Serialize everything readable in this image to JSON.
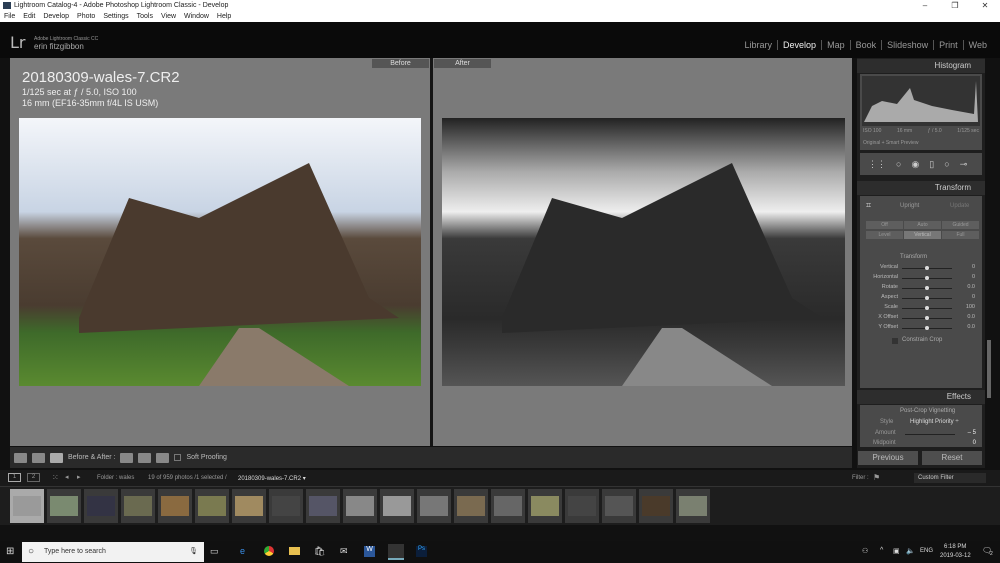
{
  "window": {
    "title": "Lightroom Catalog-4 - Adobe Photoshop Lightroom Classic - Develop",
    "min": "–",
    "max": "❐",
    "close": "✕"
  },
  "menu": [
    "File",
    "Edit",
    "Develop",
    "Photo",
    "Settings",
    "Tools",
    "View",
    "Window",
    "Help"
  ],
  "brand": {
    "logo": "Lr",
    "product": "Adobe Lightroom Classic CC",
    "user": "erin fitzgibbon"
  },
  "modules": [
    "Library",
    "Develop",
    "Map",
    "Book",
    "Slideshow",
    "Print",
    "Web"
  ],
  "view": {
    "before": "Before",
    "after": "After",
    "filename": "20180309-wales-7.CR2",
    "exposure": "1/125 sec at ƒ / 5.0, ISO 100",
    "lens": "16 mm (EF16-35mm f/4L IS USM)"
  },
  "toolbar": {
    "before_after": "Before & After :",
    "soft_proofing": "Soft Proofing"
  },
  "histogram": {
    "title": "Histogram",
    "iso": "ISO 100",
    "focal": "16 mm",
    "aperture": "ƒ / 5.0",
    "shutter": "1/125 sec",
    "preview": "Original + Smart Preview"
  },
  "transform": {
    "title": "Transform",
    "upright": "Upright",
    "update": "Update",
    "buttons": [
      "Off",
      "Auto",
      "Guided",
      "Level",
      "Vertical",
      "Full"
    ],
    "section": "Transform",
    "sliders": [
      {
        "label": "Vertical",
        "value": "0"
      },
      {
        "label": "Horizontal",
        "value": "0"
      },
      {
        "label": "Rotate",
        "value": "0.0"
      },
      {
        "label": "Aspect",
        "value": "0"
      },
      {
        "label": "Scale",
        "value": "100"
      },
      {
        "label": "X Offset",
        "value": "0.0"
      },
      {
        "label": "Y Offset",
        "value": "0.0"
      }
    ],
    "constrain": "Constrain Crop"
  },
  "effects": {
    "title": "Effects",
    "section": "Post-Crop Vignetting",
    "style_label": "Style",
    "style_value": "Highlight Priority ÷",
    "amount_label": "Amount",
    "amount_value": "– 5",
    "midpoint_label": "Midpoint",
    "midpoint_value": "0"
  },
  "actions": {
    "previous": "Previous",
    "reset": "Reset"
  },
  "filmstrip": {
    "page1": "1",
    "page2": "2",
    "source": "Folder : wales",
    "count": "19 of 959 photos /1 selected /",
    "selected": "20180309-wales-7.CR2 ▾",
    "filter_label": "Filter :",
    "filter_value": "Custom Filter",
    "thumbs": [
      "#9a9a9a",
      "#7a8a70",
      "#334",
      "#6a6a50",
      "#8a6a40",
      "#7a7a50",
      "#a08a60",
      "#444",
      "#556",
      "#888",
      "#999",
      "#777",
      "#7a6a50",
      "#666",
      "#8a8a60",
      "#444",
      "#555",
      "#4a3a2a",
      "#7a8070"
    ]
  },
  "taskbar": {
    "search": "Type here to search",
    "lang": "ENG",
    "time": "6:18 PM",
    "date": "2019-03-12",
    "notif": "2"
  }
}
